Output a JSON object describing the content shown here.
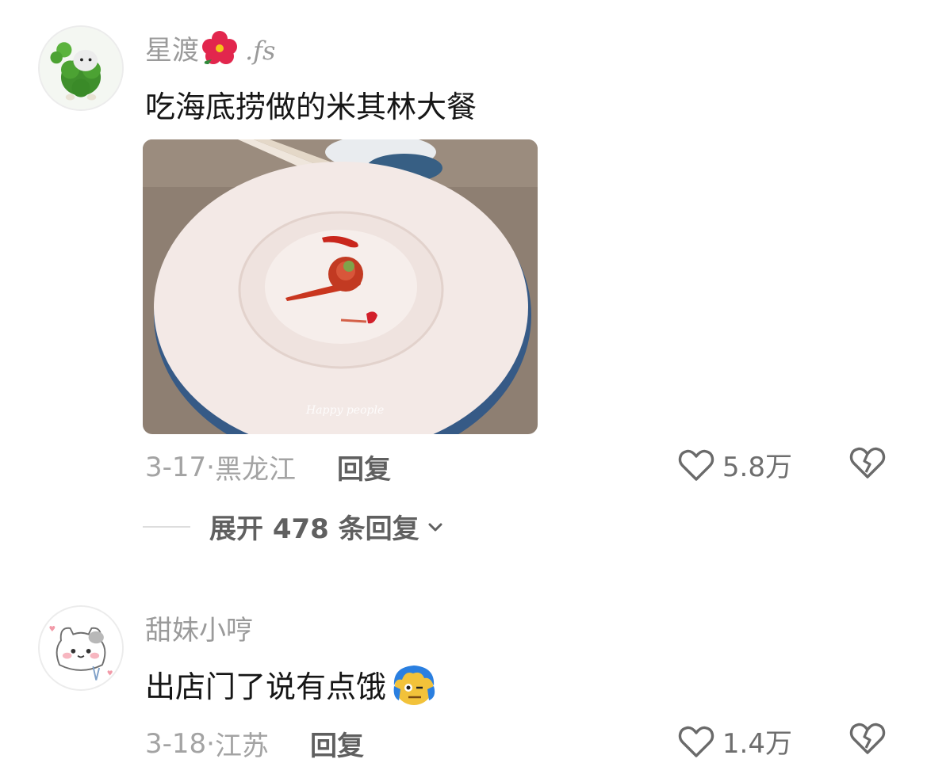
{
  "comments": [
    {
      "username": "星渡",
      "username_suffix": ".fs",
      "text": "吃海底捞做的米其林大餐",
      "photo_watermark": "Happy people",
      "date": "3-17",
      "location": "黑龙江",
      "reply_label": "回复",
      "likes": "5.8万"
    },
    {
      "username": "甜妹小哼",
      "text": "出店门了说有点饿",
      "date": "3-18",
      "location": "江苏",
      "reply_label": "回复",
      "likes": "1.4万"
    }
  ],
  "expand_replies": {
    "label": "展开 478 条回复"
  },
  "icons": {
    "like": "heart-outline-icon",
    "dislike": "broken-heart-icon",
    "expand": "chevron-down-icon",
    "flower": "hibiscus-emoji-icon",
    "emoji": "blue-hair-face-emoji-icon"
  },
  "colors": {
    "username": "#9a9a9a",
    "text": "#161616",
    "meta": "#a3a3a3"
  }
}
